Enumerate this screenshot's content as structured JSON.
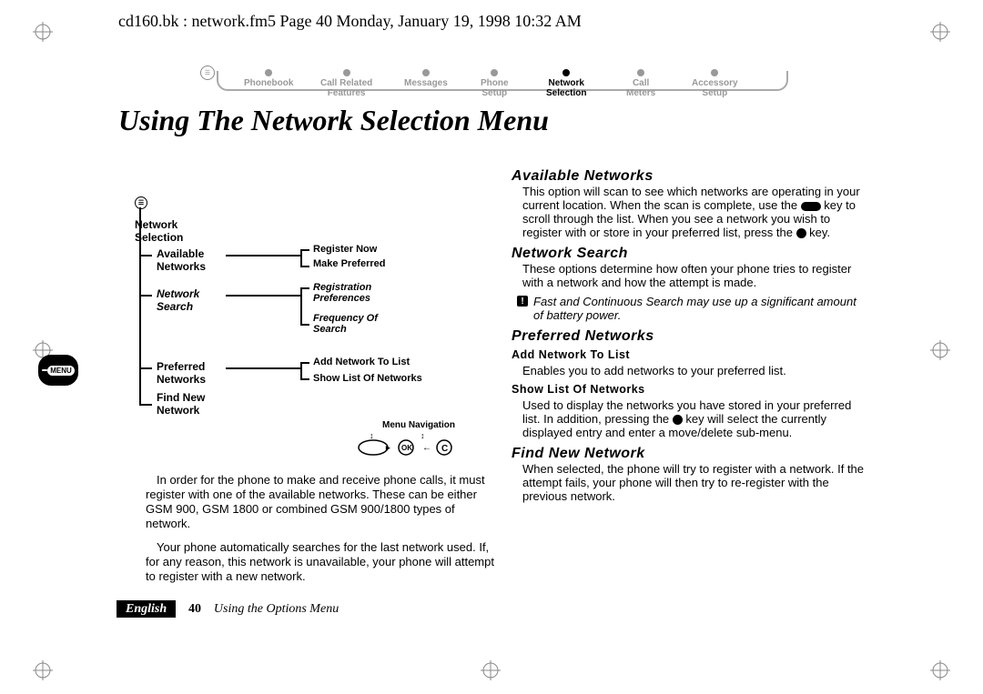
{
  "header_line": "cd160.bk : network.fm5  Page 40  Monday, January 19, 1998  10:32 AM",
  "title": "Using The Network Selection Menu",
  "nav": [
    {
      "l1": "Phonebook",
      "l2": ""
    },
    {
      "l1": "Call Related",
      "l2": "Features"
    },
    {
      "l1": "Messages",
      "l2": ""
    },
    {
      "l1": "Phone",
      "l2": "Setup"
    },
    {
      "l1": "Network",
      "l2": "Selection",
      "active": true
    },
    {
      "l1": "Call",
      "l2": "Meters"
    },
    {
      "l1": "Accessory",
      "l2": "Setup"
    }
  ],
  "tree": {
    "root": "Network Selection",
    "items": [
      {
        "label": "Available Networks",
        "subs": [
          "Register Now",
          "Make Preferred"
        ],
        "italic": false
      },
      {
        "label": "Network Search",
        "subs": [
          "Registration Preferences",
          "Frequency Of Search"
        ],
        "italic": true
      },
      {
        "label": "Preferred Networks",
        "subs": [
          "Add Network To List",
          "Show List Of Networks"
        ],
        "italic": false
      },
      {
        "label": "Find New Network",
        "subs": [],
        "italic": false
      }
    ],
    "caption": "Menu Navigation"
  },
  "left_paras": [
    "In order for the phone to make and receive phone calls, it must register with one of the available networks. These can be either GSM 900, GSM 1800 or combined GSM 900/1800 types of network.",
    "Your phone automatically searches for the last network used. If, for any reason, this network is unavailable, your phone will attempt to register with a new network."
  ],
  "sections": {
    "available": {
      "h": "Available Networks",
      "p_a": "This option will scan to see which networks are operating in your current location. When the scan is complete, use the ",
      "p_b": " key to scroll through the list. When you see a network you wish to register with or store in your preferred list, press the ",
      "p_c": " key."
    },
    "search": {
      "h": "Network Search",
      "p": "These options determine how often your phone tries to register with a network and how the attempt is made.",
      "note": "Fast and Continuous Search may use up a significant amount of battery power."
    },
    "preferred": {
      "h": "Preferred Networks",
      "sub1": "Add Network To List",
      "sub1_p": "Enables you to add networks to your preferred list.",
      "sub2": "Show List Of Networks",
      "sub2_p_a": "Used to display the networks you have stored in your preferred list. In addition, pressing the ",
      "sub2_p_b": " key will select the currently displayed entry and enter a move/delete sub-menu."
    },
    "findnew": {
      "h": "Find New Network",
      "p": "When selected, the phone will try to register with a network. If the attempt fails, your phone will then try to re-register with the previous network."
    }
  },
  "footer": {
    "lang": "English",
    "page": "40",
    "section": "Using the Options Menu"
  },
  "menu_tab": "MENU"
}
